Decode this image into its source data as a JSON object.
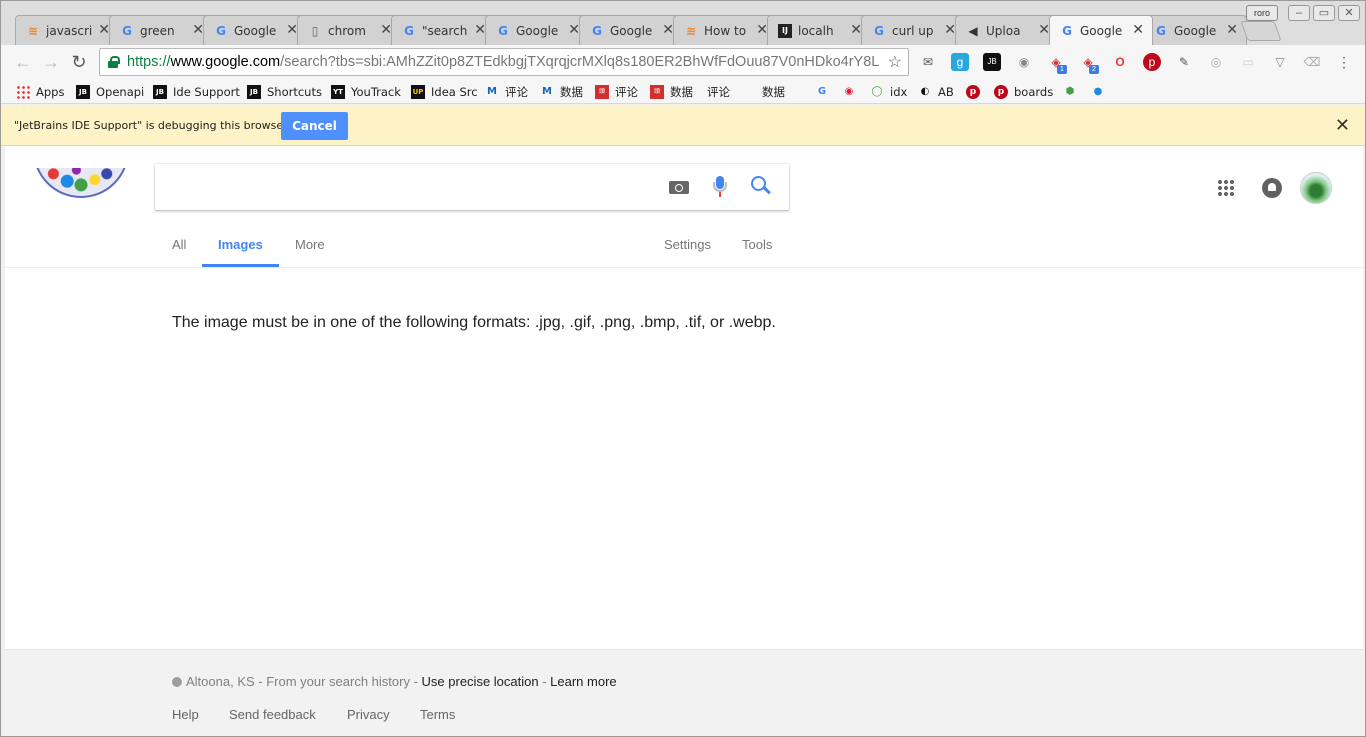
{
  "tabs": [
    {
      "icon": "stackoverflow-icon",
      "title": "javascri"
    },
    {
      "icon": "google-icon",
      "title": "green"
    },
    {
      "icon": "google-icon",
      "title": "Google"
    },
    {
      "icon": "page-icon",
      "title": "chrom"
    },
    {
      "icon": "google-icon",
      "title": "\"search"
    },
    {
      "icon": "google-icon",
      "title": "Google"
    },
    {
      "icon": "google-icon",
      "title": "Google"
    },
    {
      "icon": "stackoverflow-icon",
      "title": "How to"
    },
    {
      "icon": "jetbrains-icon",
      "title": "localh"
    },
    {
      "icon": "google-icon",
      "title": "curl up"
    },
    {
      "icon": "megaphone-icon",
      "title": "Uploa"
    },
    {
      "icon": "google-icon",
      "title": "Google",
      "active": true
    },
    {
      "icon": "google-icon",
      "title": "Google"
    }
  ],
  "profile": "roro",
  "address": {
    "scheme": "https://",
    "host": "www.google.com",
    "path": "/search?tbs=sbi:AMhZZit0p8ZTEdkbgjTXqrqjcrMXlq8s180ER2BhWfFdOuu87V0nHDko4rY8L"
  },
  "bookmarks": [
    "Apps",
    "Openapi",
    "Ide Support",
    "Shortcuts",
    "YouTrack",
    "Idea Src",
    "评论",
    "数据",
    "评论",
    "数据",
    "评论",
    "数据",
    "",
    "",
    "idx",
    "AB",
    "",
    "boards",
    "",
    ""
  ],
  "infobar": {
    "message": "\"JetBrains IDE Support\" is debugging this browser.",
    "cancel": "Cancel"
  },
  "search": {
    "query": ""
  },
  "nav_tabs": {
    "all": "All",
    "images": "Images",
    "more": "More",
    "settings": "Settings",
    "tools": "Tools"
  },
  "message": "The image must be in one of the following formats: .jpg, .gif, .png, .bmp, .tif, or .webp.",
  "footer": {
    "location": "Altoona, KS",
    "location_suffix": " - From your search history - ",
    "precise": "Use precise location",
    "sep": " - ",
    "learn": "Learn more",
    "help": "Help",
    "feedback": "Send feedback",
    "privacy": "Privacy",
    "terms": "Terms"
  },
  "colors": {
    "accent": "#4285f4",
    "infobar": "#fdf3c6",
    "cancel_button": "#4d90fe",
    "secure": "#0b8043"
  }
}
